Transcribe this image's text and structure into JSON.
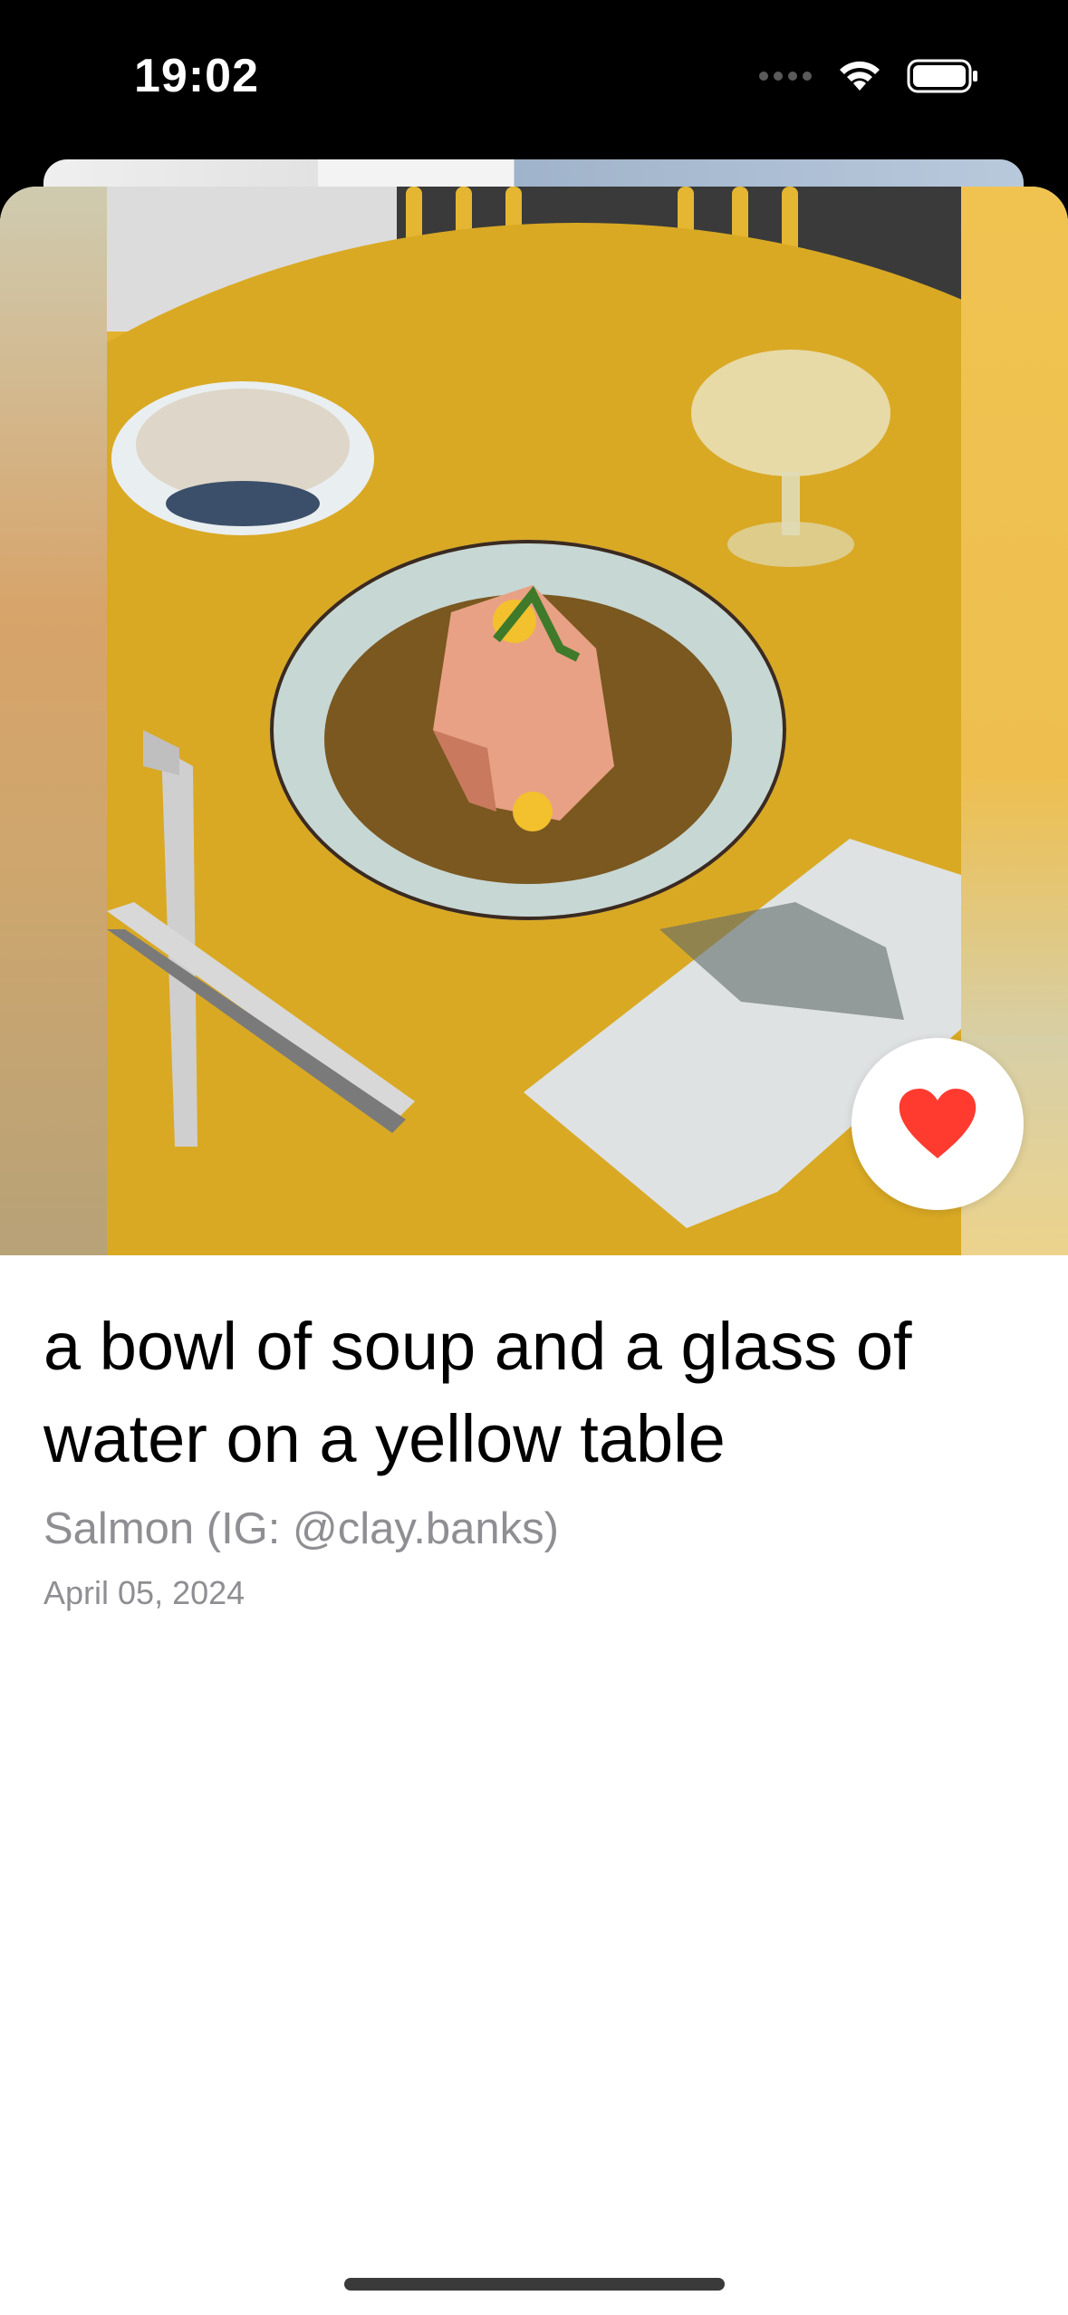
{
  "status_bar": {
    "time": "19:02",
    "icons": [
      "cellular-dots-icon",
      "wifi-icon",
      "battery-icon"
    ]
  },
  "photo": {
    "description_icon": "food-photo",
    "favorite": true,
    "favorite_icon": "heart-icon",
    "favorite_color": "#ff3b30"
  },
  "details": {
    "title": "a bowl of soup and a glass of water on a yellow table",
    "author": "Salmon (IG: @clay.banks)",
    "date": "April 05, 2024"
  },
  "colors": {
    "accent": "#ff3b30",
    "secondary_text": "#8e8e93",
    "background": "#ffffff"
  }
}
